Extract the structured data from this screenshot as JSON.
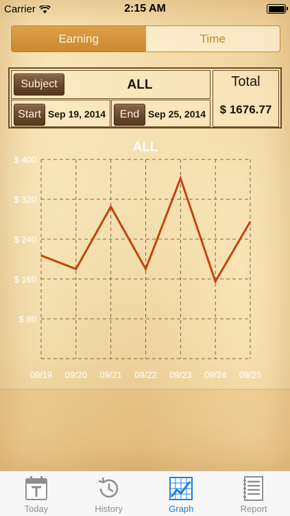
{
  "status_bar": {
    "carrier": "Carrier",
    "time": "2:15 AM"
  },
  "segmented": {
    "earning": "Earning",
    "time": "Time",
    "selected": "Earning"
  },
  "panel": {
    "subject_button": "Subject",
    "subject_value": "ALL",
    "start_button": "Start",
    "start_date": "Sep 19, 2014",
    "end_button": "End",
    "end_date": "Sep 25, 2014",
    "total_label": "Total",
    "total_value": "$ 1676.77"
  },
  "chart_data": {
    "type": "line",
    "title": "ALL",
    "categories": [
      "09/19",
      "09/20",
      "09/21",
      "09/22",
      "09/23",
      "09/24",
      "09/25"
    ],
    "series": [
      {
        "values": [
          207,
          180,
          305,
          180,
          362,
          155,
          275
        ]
      }
    ],
    "ylim": [
      0,
      400
    ],
    "y_ticks": [
      80,
      160,
      240,
      320,
      400
    ],
    "y_tick_labels": [
      "$ 80",
      "$ 160",
      "$ 240",
      "$ 320",
      "$ 400"
    ],
    "grid": true,
    "line_color": "#c0440e",
    "grid_color": "#7a6545"
  },
  "tabbar": {
    "items": [
      {
        "label": "Today",
        "icon": "calendar-icon"
      },
      {
        "label": "History",
        "icon": "clock-history-icon"
      },
      {
        "label": "Graph",
        "icon": "line-graph-icon"
      },
      {
        "label": "Report",
        "icon": "report-list-icon"
      }
    ],
    "selected": "Graph"
  },
  "colors": {
    "accent": "#c98a30",
    "panel_border": "#6b4a25",
    "tab_selected": "#1d7fdb"
  }
}
